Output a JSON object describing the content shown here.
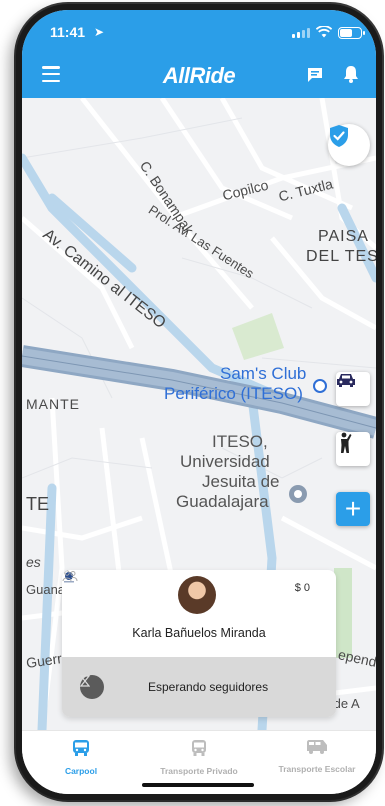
{
  "status_bar": {
    "time": "11:41"
  },
  "header": {
    "title": "AllRide"
  },
  "map": {
    "labels": {
      "bonampak": "C. Bonampak",
      "copilco": "Copilco",
      "tuxtla": "C. Tuxtla",
      "las_fuentes": "Prol. Av. Las Fuentes",
      "camino_iteso": "Av. Camino al ITESO",
      "paisa": "PAISA",
      "del_tes": "DEL TES",
      "sams_1": "Sam's Club",
      "sams_2": "Periférico (ITESO)",
      "mante": "MANTE",
      "iteso_1": "ITESO,",
      "iteso_2": "Universidad",
      "iteso_3": "Jesuita de",
      "iteso_4": "Guadalajara",
      "te": "TE",
      "es": "es",
      "guana": "Guana",
      "guerre": "Guerre",
      "ependen": "epend",
      "bahia": "Bahía de A"
    }
  },
  "trip_card": {
    "price": "$ 0",
    "driver_name": "Karla  Bañuelos Miranda",
    "status": "Esperando seguidores"
  },
  "tabs": [
    {
      "label": "Carpool",
      "active": true
    },
    {
      "label": "Transporte Privado",
      "active": false
    },
    {
      "label": "Transporte Escolar",
      "active": false
    }
  ],
  "colors": {
    "brand": "#2b9ee8",
    "car_fab": "#2a2a5e"
  }
}
